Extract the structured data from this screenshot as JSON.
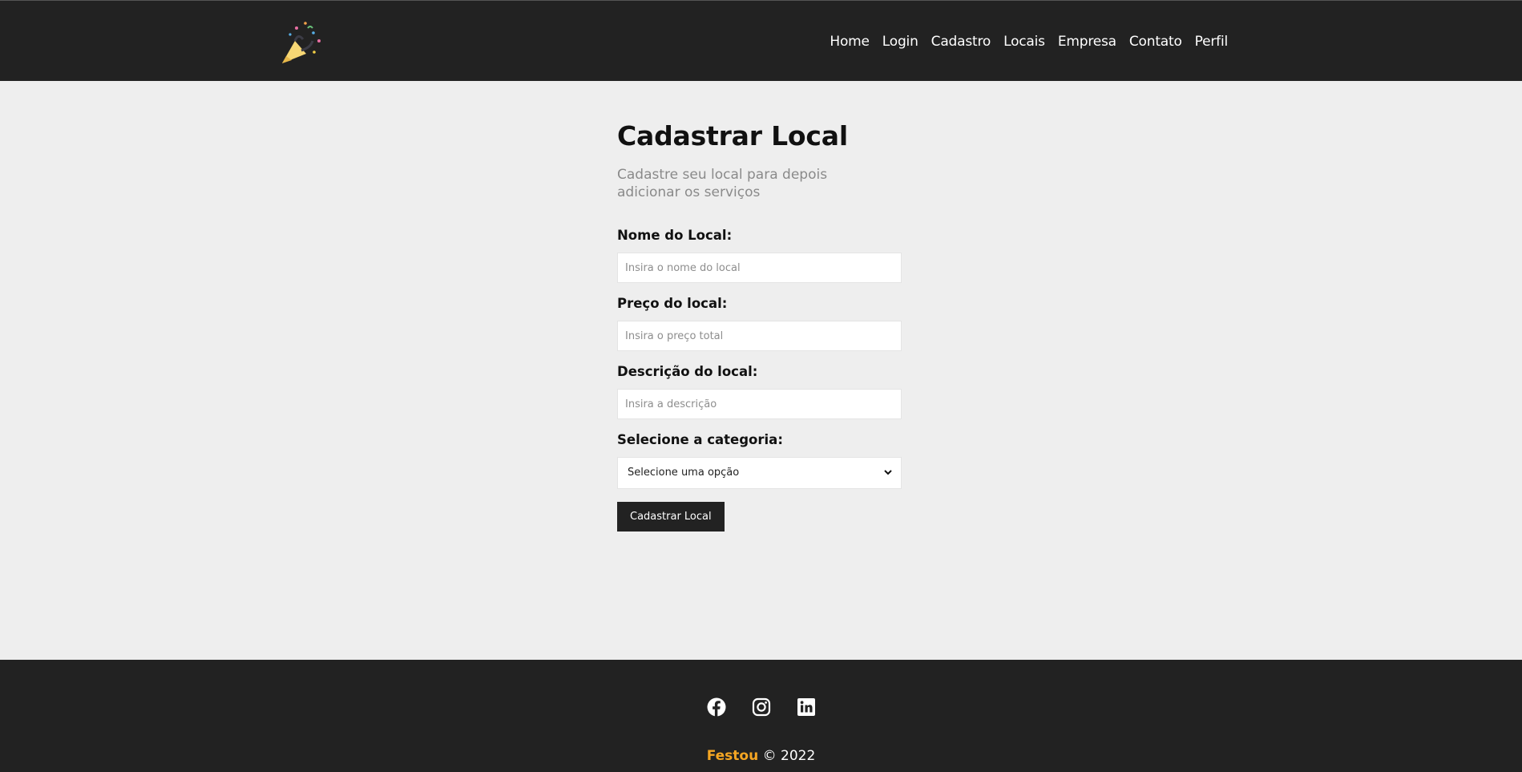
{
  "header": {
    "logo_icon": "party-popper-icon",
    "nav": [
      {
        "label": "Home"
      },
      {
        "label": "Login"
      },
      {
        "label": "Cadastro"
      },
      {
        "label": "Locais"
      },
      {
        "label": "Empresa"
      },
      {
        "label": "Contato"
      },
      {
        "label": "Perfil"
      }
    ]
  },
  "main": {
    "title": "Cadastrar Local",
    "subtitle": "Cadastre seu local para depois adicionar os serviços",
    "form": {
      "name_label": "Nome do Local:",
      "name_placeholder": "Insira o nome do local",
      "price_label": "Preço do local:",
      "price_placeholder": "Insira o preço total",
      "description_label": "Descrição do local:",
      "description_placeholder": "Insira a descrição",
      "category_label": "Selecione a categoria:",
      "category_value": "Selecione uma opção",
      "submit_label": "Cadastrar Local"
    }
  },
  "footer": {
    "socials": [
      "facebook-icon",
      "instagram-icon",
      "linkedin-icon"
    ],
    "brand": "Festou",
    "copyright": "© 2022",
    "brand_color": "#f5a623"
  },
  "colors": {
    "header_bg": "#222222",
    "page_bg": "#eeeeee",
    "button_bg": "#222222"
  }
}
